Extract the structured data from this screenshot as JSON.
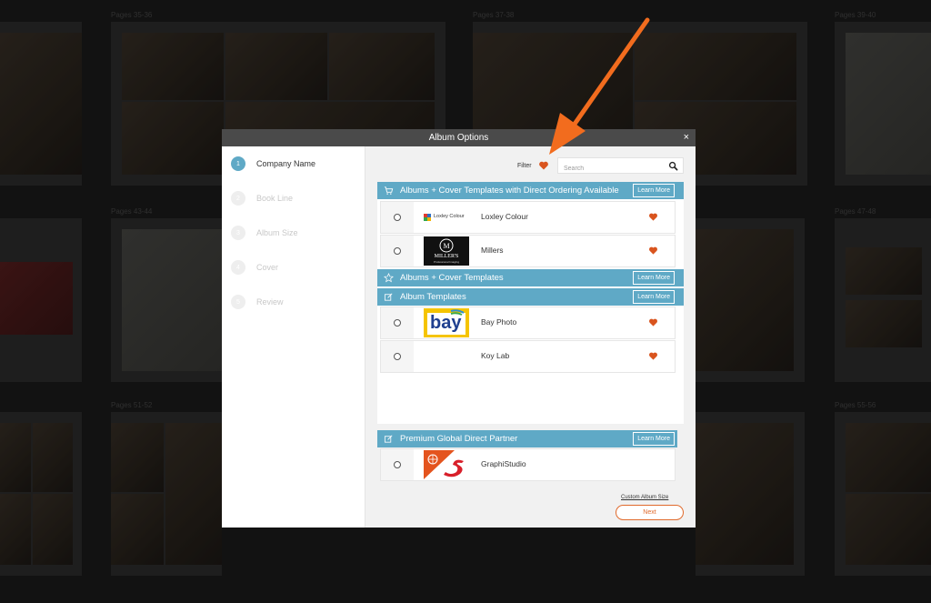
{
  "background": {
    "page_labels": [
      "Pages 35-36",
      "Pages 37-38",
      "Pages 39-40",
      "Pages 43-44",
      "Pages 47-48",
      "Pages 51-52",
      "Pages 55-56"
    ]
  },
  "modal": {
    "title": "Album Options",
    "close_glyph": "×"
  },
  "steps": [
    {
      "num": "1",
      "label": "Company Name",
      "active": true
    },
    {
      "num": "2",
      "label": "Book Line",
      "active": false
    },
    {
      "num": "3",
      "label": "Album Size",
      "active": false
    },
    {
      "num": "4",
      "label": "Cover",
      "active": false
    },
    {
      "num": "5",
      "label": "Review",
      "active": false
    }
  ],
  "filter": {
    "label": "Filter",
    "icon": "heart-icon"
  },
  "search": {
    "placeholder": "Search",
    "value": "",
    "icon": "search-icon"
  },
  "sections": [
    {
      "title": "Albums + Cover Templates with Direct Ordering Available",
      "icon": "cart-icon",
      "learn_more": "Learn More",
      "companies": [
        {
          "name": "Loxley Colour",
          "logo_text": "Loxley Colour",
          "favorite": true
        },
        {
          "name": "Millers",
          "logo_text": "MILLER'S",
          "logo_subtext": "Professional Imaging",
          "favorite": true
        }
      ]
    },
    {
      "title": "Albums + Cover Templates",
      "icon": "star-icon",
      "learn_more": "Learn More",
      "companies": []
    },
    {
      "title": "Album Templates",
      "icon": "edit-icon",
      "learn_more": "Learn More",
      "companies": [
        {
          "name": "Bay Photo",
          "logo_text": "bay",
          "favorite": true
        },
        {
          "name": "Koy Lab",
          "favorite": true
        }
      ]
    }
  ],
  "partner_section": {
    "title": "Premium Global Direct Partner",
    "icon": "edit-icon",
    "learn_more": "Learn More",
    "companies": [
      {
        "name": "GraphiStudio",
        "favorite": false
      }
    ]
  },
  "footer": {
    "custom_size": "Custom Album Size",
    "next": "Next"
  },
  "colors": {
    "accent_blue": "#5fa9c6",
    "accent_orange": "#e06a2c",
    "heart": "#d9541e",
    "annotation_arrow": "#f26c1e"
  }
}
